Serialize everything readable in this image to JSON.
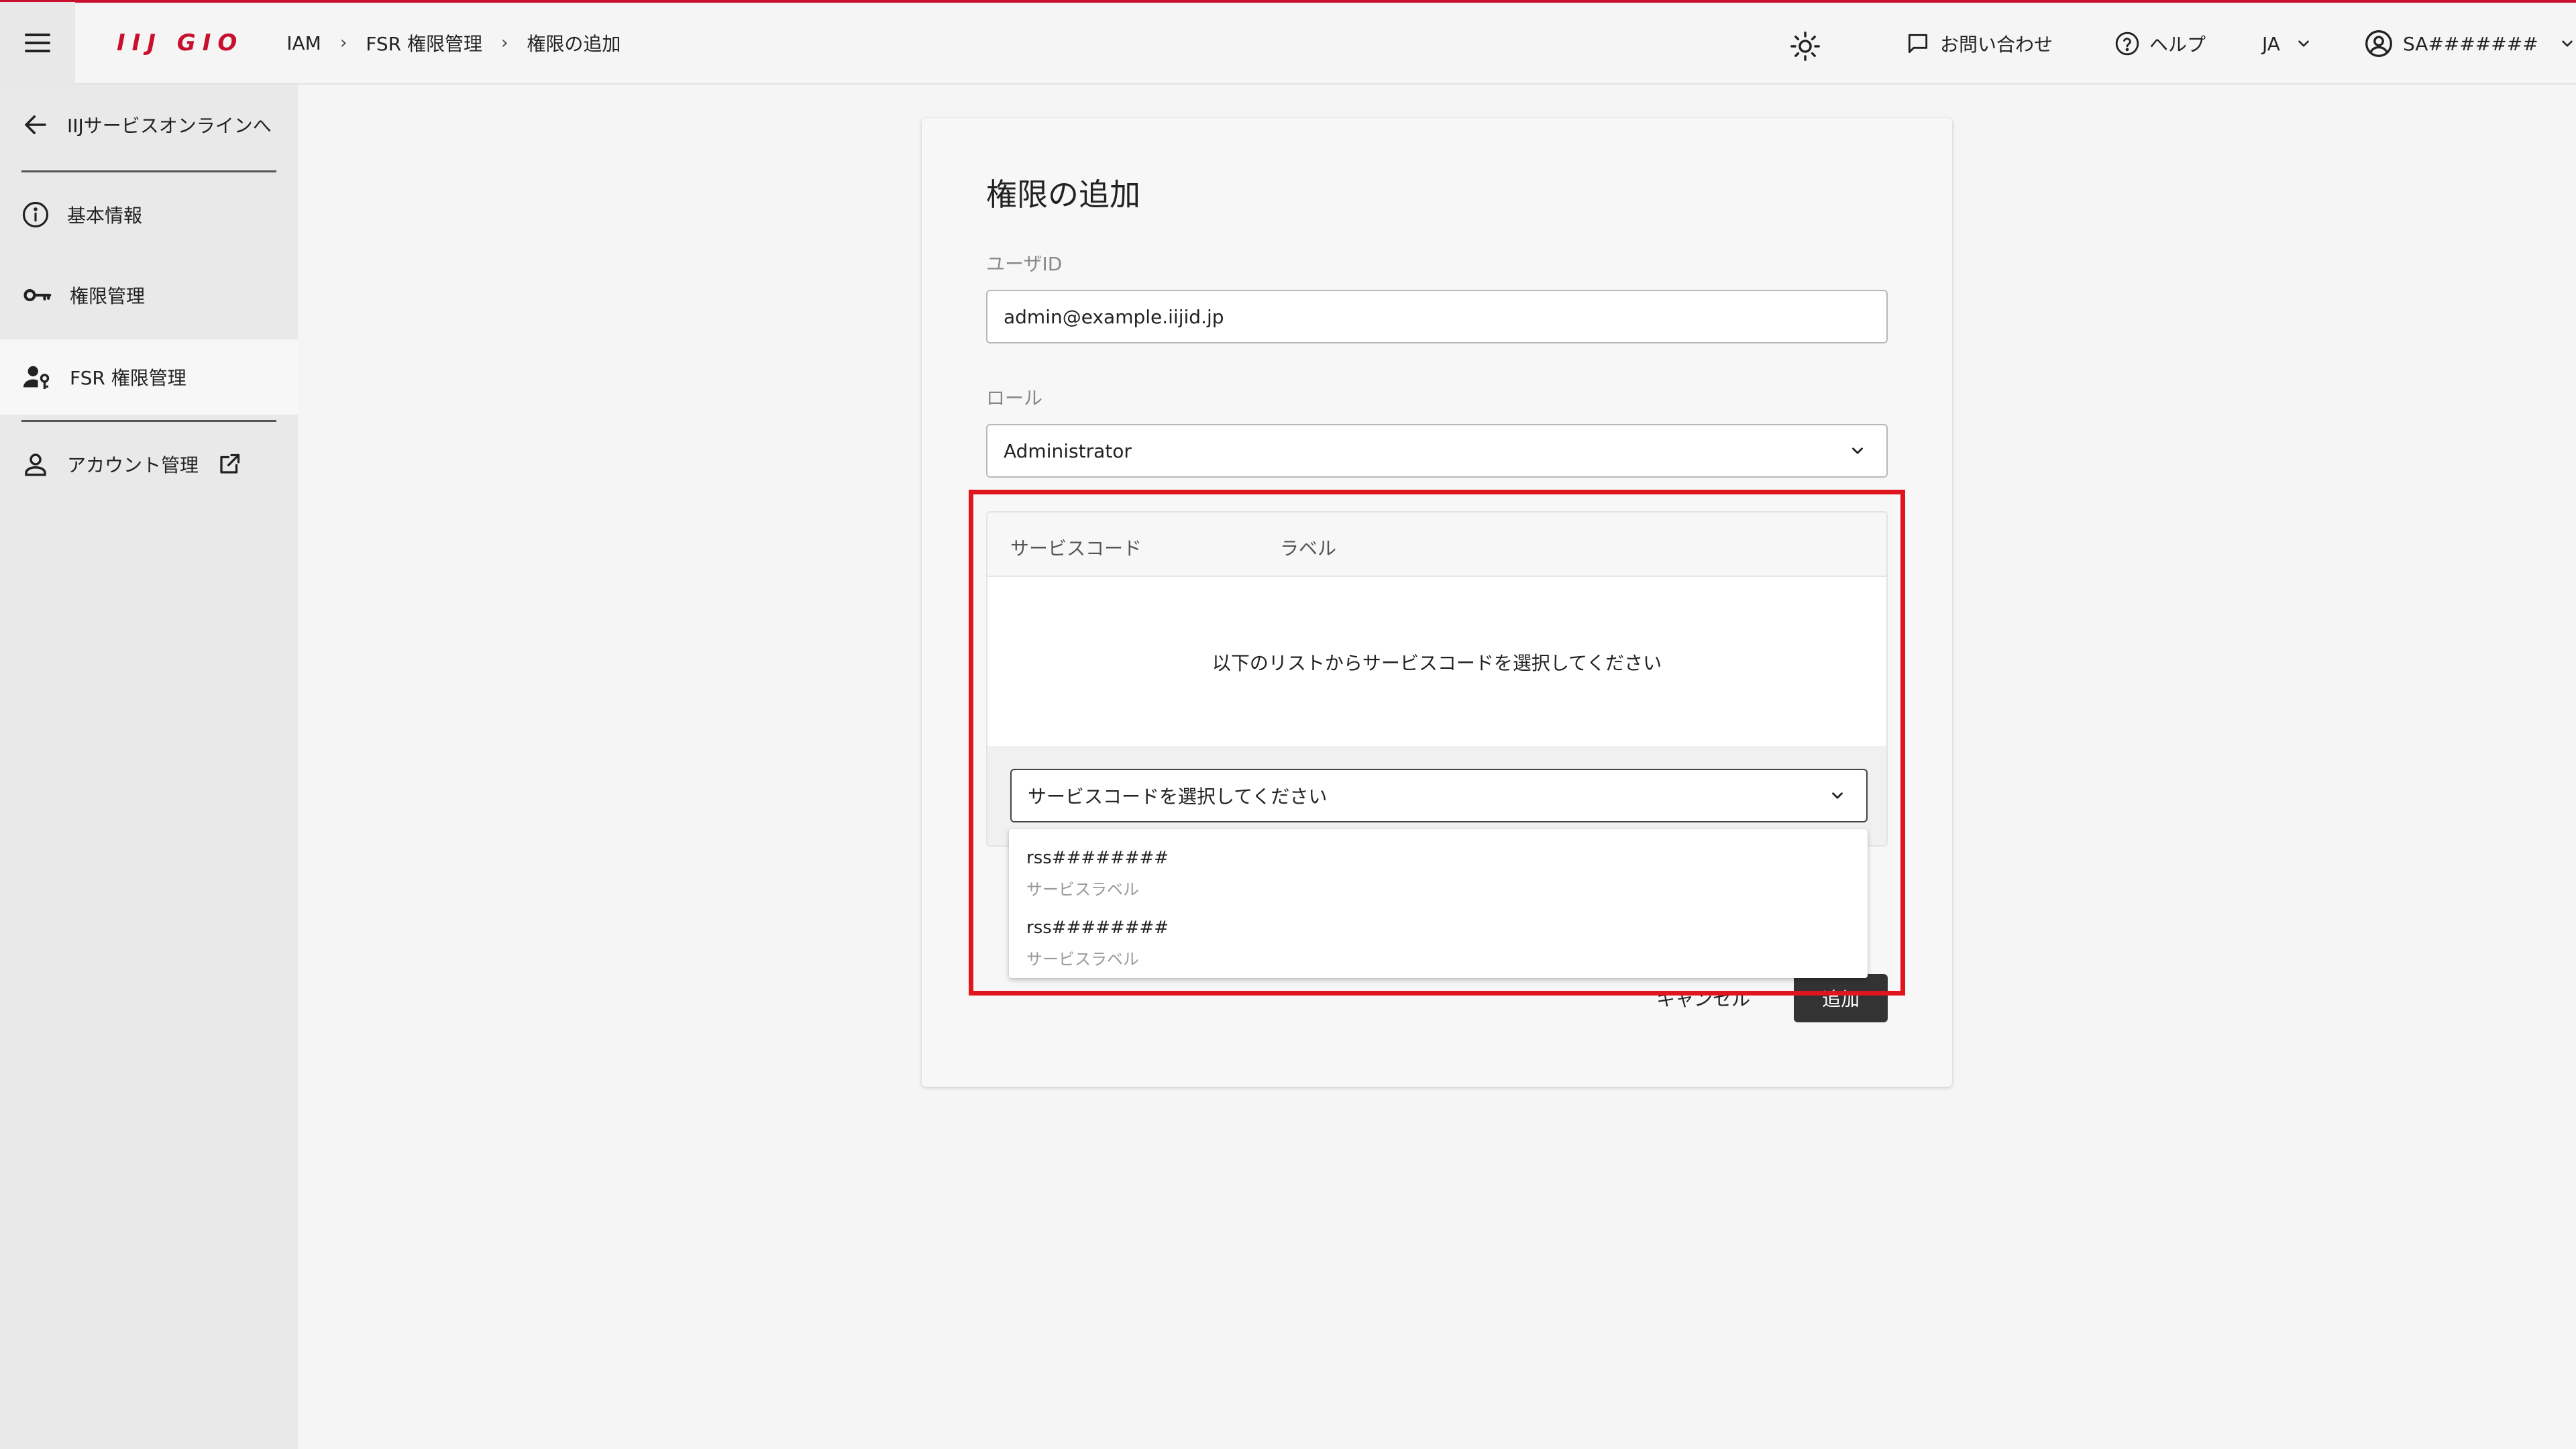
{
  "header": {
    "logo": "IIJ GIO",
    "breadcrumbs": [
      "IAM",
      "FSR 権限管理",
      "権限の追加"
    ],
    "breadcrumb_sep": "›",
    "contact": "お問い合わせ",
    "help": "ヘルプ",
    "language": "JA",
    "account": "SA#######"
  },
  "sidebar": {
    "back": "IIJサービスオンラインへ",
    "items": [
      {
        "label": "基本情報",
        "icon": "info-icon"
      },
      {
        "label": "権限管理",
        "icon": "key-icon"
      },
      {
        "label": "FSR 権限管理",
        "icon": "user-key-icon",
        "active": true
      },
      {
        "label": "アカウント管理",
        "icon": "person-icon",
        "external": true
      }
    ]
  },
  "form": {
    "title": "権限の追加",
    "user_id_label": "ユーザID",
    "user_id_value": "admin@example.iijid.jp",
    "role_label": "ロール",
    "role_value": "Administrator",
    "table": {
      "col_code": "サービスコード",
      "col_label": "ラベル",
      "empty_message": "以下のリストからサービスコードを選択してください",
      "select_placeholder": "サービスコードを選択してください"
    },
    "options": [
      {
        "code": "rss########",
        "label": "サービスラベル"
      },
      {
        "code": "rss########",
        "label": "サービスラベル"
      }
    ],
    "cancel": "キャンセル",
    "add": "追加"
  },
  "colors": {
    "brand": "#c8102e",
    "highlight": "#e0151e",
    "primary_button": "#333333"
  }
}
